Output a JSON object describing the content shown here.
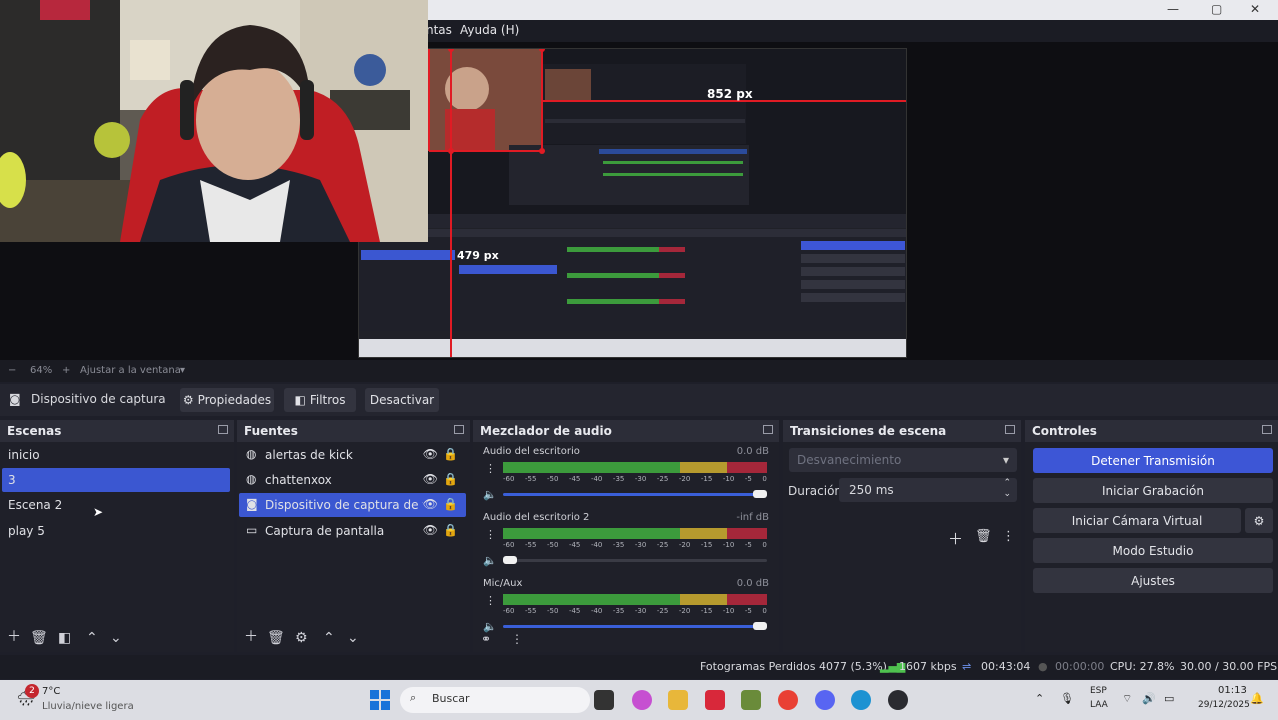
{
  "window": {
    "menu_items": [
      "ntas",
      "Ayuda (H)"
    ],
    "controls": {
      "minimize": "—",
      "maximize": "▢",
      "close": "✕"
    }
  },
  "preview": {
    "measure_horizontal": "852 px",
    "measure_vertical": "479 px"
  },
  "zoom": {
    "minus": "−",
    "level": "64%",
    "plus": "+",
    "fit_label": "Ajustar a la ventana"
  },
  "toolbar": {
    "source_name": "Dispositivo de captura de v",
    "properties": "Propiedades",
    "filters": "Filtros",
    "deactivate": "Desactivar"
  },
  "scenes": {
    "title": "Escenas",
    "items": [
      "inicio",
      "3",
      "Escena 2",
      "play 5"
    ],
    "selected_index": 1
  },
  "sources": {
    "title": "Fuentes",
    "items": [
      {
        "label": "alertas de kick",
        "icon": "globe-icon"
      },
      {
        "label": "chattenxox",
        "icon": "globe-icon"
      },
      {
        "label": "Dispositivo de captura de vídeo",
        "icon": "camera-icon"
      },
      {
        "label": "Captura de pantalla",
        "icon": "monitor-icon"
      }
    ],
    "selected_index": 2
  },
  "mixer": {
    "title": "Mezclador de audio",
    "scale": [
      "-60",
      "-55",
      "-50",
      "-45",
      "-40",
      "-35",
      "-30",
      "-25",
      "-20",
      "-15",
      "-10",
      "-5",
      "0"
    ],
    "tracks": [
      {
        "name": "Audio del escritorio",
        "db": "0.0 dB",
        "volume": 1.0
      },
      {
        "name": "Audio del escritorio 2",
        "db": "-inf dB",
        "volume": 0.0
      },
      {
        "name": "Mic/Aux",
        "db": "0.0 dB",
        "volume": 1.0
      }
    ]
  },
  "transitions": {
    "title": "Transiciones de escena",
    "selected": "Desvanecimiento",
    "duration_label": "Duración",
    "duration_value": "250 ms"
  },
  "controls": {
    "title": "Controles",
    "stop_stream": "Detener Transmisión",
    "start_recording": "Iniciar Grabación",
    "start_virtual_cam": "Iniciar Cámara Virtual",
    "studio_mode": "Modo Estudio",
    "settings": "Ajustes"
  },
  "status": {
    "dropped_frames": "Fotogramas Perdidos 4077 (5.3%)",
    "bitrate": "1607 kbps",
    "stream_time": "00:43:04",
    "rec_time": "00:00:00",
    "cpu": "CPU: 27.8%",
    "fps": "30.00 / 30.00 FPS"
  },
  "taskbar": {
    "weather_temp": "7°C",
    "weather_desc": "Lluvia/nieve ligera",
    "weather_badge": "2",
    "search_placeholder": "Buscar",
    "lang_top": "ESP",
    "lang_bottom": "LAA",
    "time": "01:13",
    "date": "29/12/2025"
  },
  "colors": {
    "accent": "#3b57d1",
    "meter_green": "#3c9b3c",
    "meter_yellow": "#b69a2e",
    "meter_red": "#a5273a",
    "guide_red": "#e01b24"
  }
}
